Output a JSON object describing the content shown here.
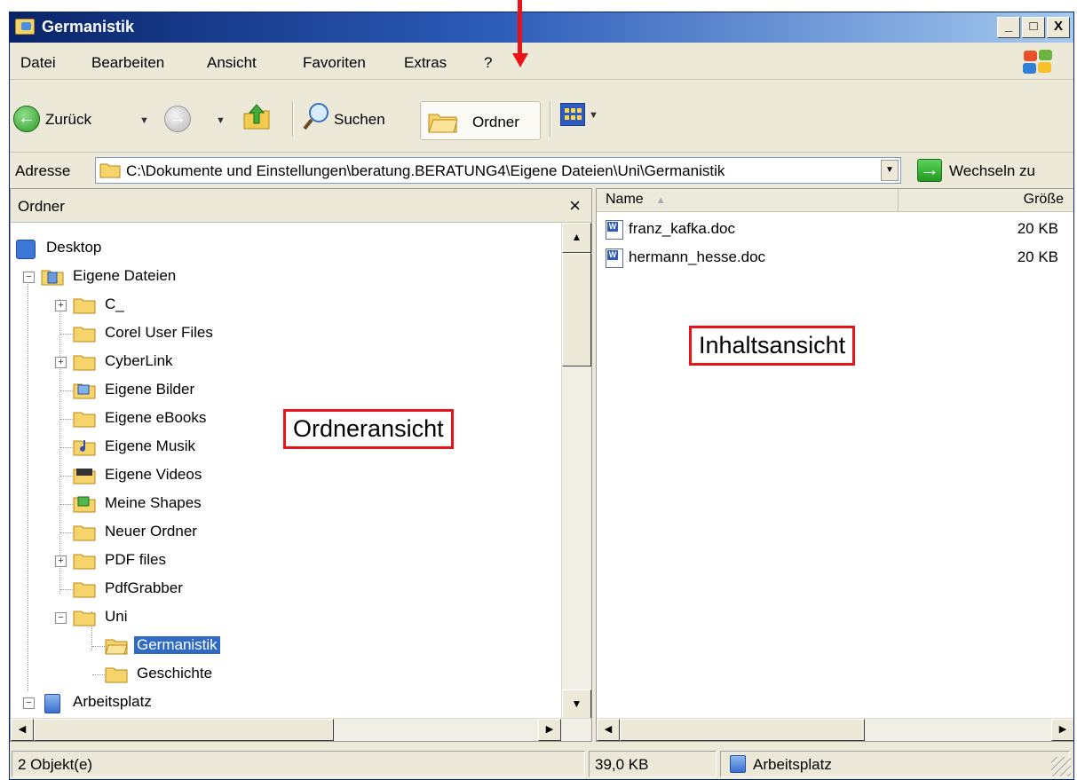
{
  "window": {
    "title": "Germanistik",
    "caption_buttons": [
      "_",
      "□",
      "X"
    ]
  },
  "menu": {
    "items": [
      {
        "label": "Datei"
      },
      {
        "label": "Bearbeiten"
      },
      {
        "label": "Ansicht"
      },
      {
        "label": "Favoriten"
      },
      {
        "label": "Extras"
      },
      {
        "label": "?"
      }
    ]
  },
  "toolbar": {
    "back_label": "Zurück",
    "search_label": "Suchen",
    "folders_label": "Ordner",
    "icons": [
      "back-arrow-icon",
      "forward-arrow-icon",
      "folder-up-icon",
      "magnifier-icon",
      "folders-icon",
      "views-icon"
    ]
  },
  "address": {
    "label": "Adresse",
    "value": "C:\\Dokumente und Einstellungen\\beratung.BERATUNG4\\Eigene Dateien\\Uni\\Germanistik",
    "go_label": "Wechseln zu"
  },
  "folder_pane": {
    "title": "Ordner",
    "close": "×",
    "tree": [
      {
        "label": "Desktop"
      },
      {
        "label": "Eigene Dateien"
      },
      {
        "label": "C_"
      },
      {
        "label": "Corel User Files"
      },
      {
        "label": "CyberLink"
      },
      {
        "label": "Eigene Bilder"
      },
      {
        "label": "Eigene eBooks"
      },
      {
        "label": "Eigene Musik"
      },
      {
        "label": "Eigene Videos"
      },
      {
        "label": "Meine Shapes"
      },
      {
        "label": "Neuer Ordner"
      },
      {
        "label": "PDF files"
      },
      {
        "label": "PdfGrabber"
      },
      {
        "label": "Uni"
      },
      {
        "label": "Germanistik",
        "selected": true
      },
      {
        "label": "Geschichte"
      },
      {
        "label": "Arbeitsplatz"
      }
    ]
  },
  "content_pane": {
    "columns": {
      "name": "Name",
      "size": "Größe"
    },
    "files": [
      {
        "name": "franz_kafka.doc",
        "size": "20 KB"
      },
      {
        "name": "hermann_hesse.doc",
        "size": "20 KB"
      }
    ]
  },
  "status": {
    "objects": "2 Objekt(e)",
    "size": "39,0 KB",
    "location": "Arbeitsplatz"
  },
  "annotations": {
    "folder_view": "Ordneransicht",
    "content_view": "Inhaltsansicht"
  },
  "colors": {
    "annotation_red": "#e8141a",
    "selection_blue": "#316ac5",
    "title_blue": "#0a246a"
  }
}
